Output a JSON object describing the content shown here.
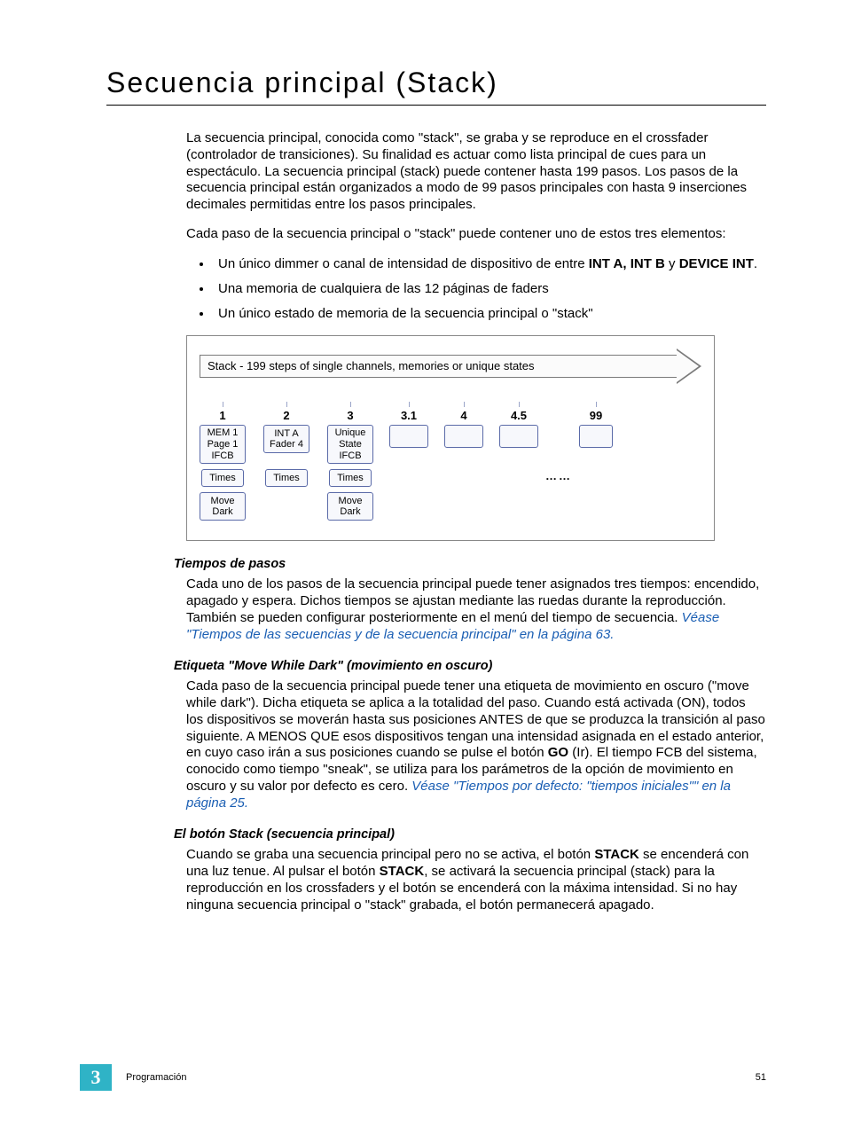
{
  "title": "Secuencia principal (Stack)",
  "intro_para": "La secuencia principal, conocida como \"stack\", se graba y se reproduce en el crossfader (controlador de transiciones).  Su finalidad es actuar como lista principal de cues para un espectáculo.  La secuencia principal (stack) puede contener hasta 199 pasos.  Los pasos de la secuencia principal están organizados a modo de 99 pasos principales con hasta 9 inserciones decimales permitidas entre los pasos principales.",
  "intro_lead": "Cada paso de la secuencia principal o \"stack\" puede contener uno de estos tres elementos:",
  "bullets": {
    "b1a": "Un único dimmer o canal de intensidad de dispositivo de entre ",
    "b1b": "INT A, INT B",
    "b1c": " y ",
    "b1d": "DEVICE INT",
    "b1e": ".",
    "b2": "Una memoria de cualquiera de las 12 páginas de faders",
    "b3": "Un único estado de memoria de la secuencia principal o \"stack\""
  },
  "diagram": {
    "arrow_label": "Stack - 199 steps of single channels, memories or unique states",
    "steps": {
      "n1": "1",
      "n2": "2",
      "n3": "3",
      "n31": "3.1",
      "n4": "4",
      "n45": "4.5",
      "n99": "99"
    },
    "box1_l1": "MEM 1",
    "box1_l2": "Page 1",
    "box1_l3": "IFCB",
    "box2_l1": "INT A",
    "box2_l2": "Fader 4",
    "box3_l1": "Unique",
    "box3_l2": "State",
    "box3_l3": "IFCB",
    "times": "Times",
    "move_dark_l1": "Move",
    "move_dark_l2": "Dark",
    "dots": "……"
  },
  "sec_tiempos": {
    "head": "Tiempos de pasos",
    "body": "Cada uno de los pasos de la secuencia principal puede tener asignados tres tiempos: encendido, apagado y espera. Dichos tiempos se ajustan mediante las ruedas durante la reproducción. También se pueden configurar posteriormente en el menú del tiempo de secuencia. ",
    "link": "Véase \"Tiempos de las secuencias y de la secuencia principal\" en la página  63."
  },
  "sec_move": {
    "head": "Etiqueta \"Move While Dark\" (movimiento en oscuro)",
    "body_a": "Cada paso de la secuencia principal puede tener una etiqueta de movimiento en oscuro (\"move while dark\"). Dicha etiqueta se aplica a la totalidad del paso. Cuando está activada (ON), todos los dispositivos se moverán hasta sus posiciones ANTES de que se produzca la transición al paso siguiente. A MENOS QUE esos dispositivos tengan una intensidad asignada en el estado anterior, en cuyo caso irán a sus posiciones cuando se pulse el botón ",
    "go": "GO",
    "body_b": " (Ir). El tiempo FCB del sistema, conocido como tiempo \"sneak\", se utiliza para los parámetros de la opción de movimiento en oscuro y su valor por defecto es cero. ",
    "link": "Véase \"Tiempos por defecto: \"tiempos iniciales\"\" en la página  25."
  },
  "sec_stack": {
    "head": "El botón Stack (secuencia principal)",
    "body_a": "Cuando se graba una secuencia principal pero no se activa, el botón ",
    "stack1": "STACK",
    "body_b": " se encenderá con una luz tenue. Al pulsar el botón ",
    "stack2": "STACK",
    "body_c": ", se activará la secuencia principal (stack) para la reproducción en los crossfaders y el botón se encenderá con la máxima intensidad. Si no hay ninguna secuencia principal o \"stack\" grabada, el botón permanecerá apagado."
  },
  "footer": {
    "chapter_num": "3",
    "section": "Programación",
    "page": "51"
  }
}
